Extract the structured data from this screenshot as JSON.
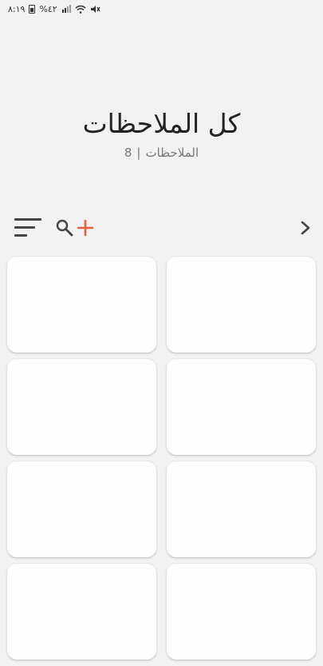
{
  "status_bar": {
    "time": "٨:١٩",
    "battery": "%٤٢",
    "icons": [
      "battery-icon",
      "signal-icon",
      "wifi-icon",
      "mute-icon"
    ]
  },
  "header": {
    "title": "كل الملاحظات",
    "subtitle_label": "الملاحظات",
    "separator": "|",
    "count": "8"
  },
  "toolbar": {
    "icons": [
      "sort-icon",
      "search-icon",
      "add-icon",
      "chevron-right-icon"
    ],
    "add_color": "#e8613c",
    "icon_color": "#444444"
  },
  "notes": [
    {
      "id": 1
    },
    {
      "id": 2
    },
    {
      "id": 3
    },
    {
      "id": 4
    },
    {
      "id": 5
    },
    {
      "id": 6
    },
    {
      "id": 7
    },
    {
      "id": 8
    }
  ]
}
